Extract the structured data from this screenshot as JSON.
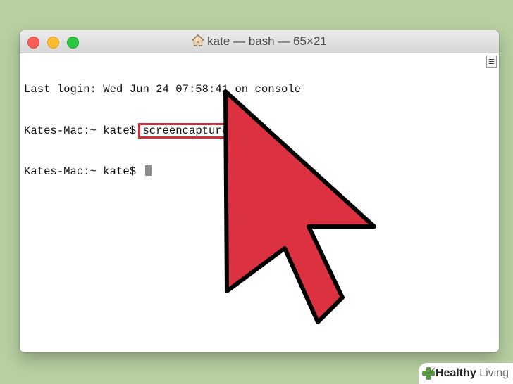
{
  "window": {
    "title": "kate — bash — 65×21"
  },
  "terminal": {
    "line1": "Last login: Wed Jun 24 07:58:41 on console",
    "prompt1": "Kates-Mac:~ kate$ ",
    "command": "screencapture -c",
    "prompt2": "Kates-Mac:~ kate$ "
  },
  "annotation": {
    "arrow_color": "#dc3140",
    "highlight_color": "#d32f3c"
  },
  "watermark": {
    "brand_bold": "Healthy",
    "brand_light": " Living",
    "brand_text": "Healthy Living",
    "icon": "plus-leaf-icon"
  },
  "icons": [
    "close-icon",
    "minimize-icon",
    "maximize-icon",
    "home-icon",
    "scroll-menu-icon",
    "pointer-arrow-icon"
  ]
}
